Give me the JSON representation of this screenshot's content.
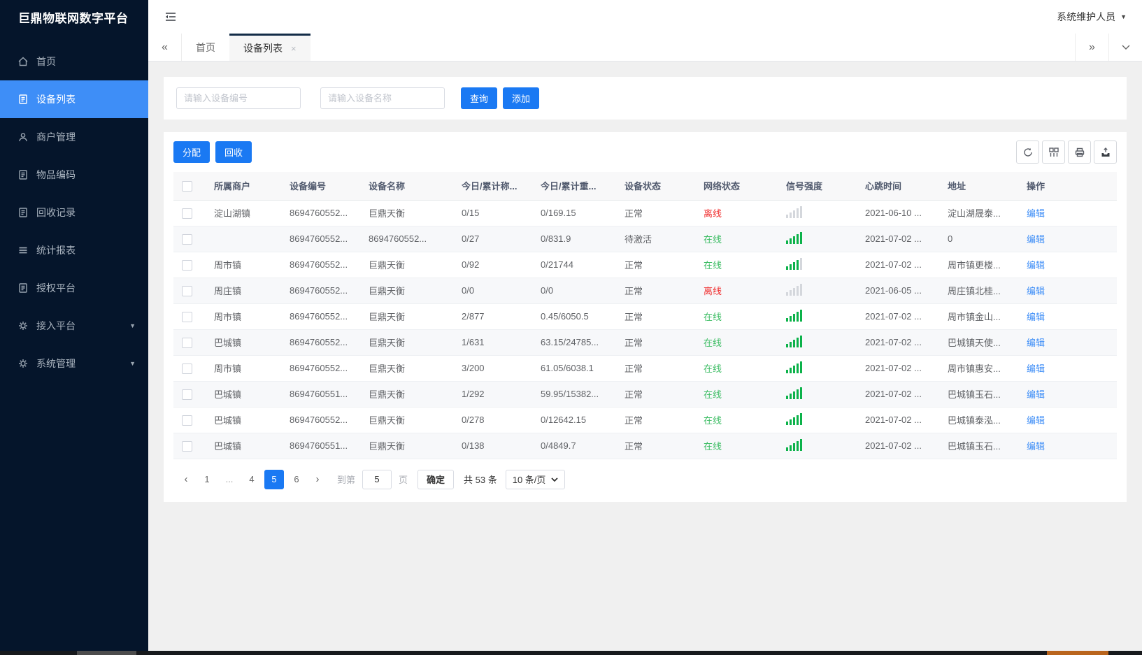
{
  "colors": {
    "accent": "#1a79f3",
    "sidebar-active": "#3e8ef7",
    "green": "#3dbd64",
    "bar-green": "#0cb24a",
    "red": "#f02d2d",
    "link": "#3e8ef7",
    "tab-border": "#132c47",
    "sidebar-bg": "#05152b"
  },
  "app": {
    "title": "巨鼎物联网数字平台"
  },
  "header": {
    "user": "系统维护人员",
    "user_caret": "▼"
  },
  "sidebar": {
    "items": [
      {
        "label": "首页",
        "icon": "home"
      },
      {
        "label": "设备列表",
        "icon": "device-list",
        "active": true
      },
      {
        "label": "商户管理",
        "icon": "merchant"
      },
      {
        "label": "物品编码",
        "icon": "item-code"
      },
      {
        "label": "回收记录",
        "icon": "recycle-record"
      },
      {
        "label": "统计报表",
        "icon": "report"
      },
      {
        "label": "授权平台",
        "icon": "authorize"
      },
      {
        "label": "接入平台",
        "icon": "access",
        "caret": "▼"
      },
      {
        "label": "系统管理",
        "icon": "system",
        "caret": "▼"
      }
    ]
  },
  "tabs": {
    "collapse": "«",
    "expand": "»",
    "items": [
      {
        "label": "首页",
        "active": false
      },
      {
        "label": "设备列表",
        "active": true,
        "close": "×"
      }
    ]
  },
  "search": {
    "device_no_placeholder": "请输入设备编号",
    "device_name_placeholder": "请输入设备名称",
    "query_label": "查询",
    "add_label": "添加"
  },
  "toolbar": {
    "assign_label": "分配",
    "recycle_label": "回收",
    "icons": [
      "refresh",
      "columns",
      "print",
      "export"
    ]
  },
  "table": {
    "columns": [
      "所属商户",
      "设备编号",
      "设备名称",
      "今日/累计称...",
      "今日/累计重...",
      "设备状态",
      "网络状态",
      "信号强度",
      "心跳时间",
      "地址",
      "操作"
    ],
    "rows": [
      {
        "merchant": "淀山湖镇",
        "device_no": "8694760552...",
        "device_name": "巨鼎天衡",
        "today_count": "0/15",
        "today_weight": "0/169.15",
        "device_status": "正常",
        "network_status": "离线",
        "network_online": false,
        "signal": 0,
        "heartbeat": "2021-06-10 ...",
        "address": "淀山湖晟泰...",
        "action": "编辑"
      },
      {
        "merchant": "",
        "device_no": "8694760552...",
        "device_name": "8694760552...",
        "today_count": "0/27",
        "today_weight": "0/831.9",
        "device_status": "待激活",
        "network_status": "在线",
        "network_online": true,
        "signal": 5,
        "heartbeat": "2021-07-02 ...",
        "address": "0",
        "action": "编辑"
      },
      {
        "merchant": "周市镇",
        "device_no": "8694760552...",
        "device_name": "巨鼎天衡",
        "today_count": "0/92",
        "today_weight": "0/21744",
        "device_status": "正常",
        "network_status": "在线",
        "network_online": true,
        "signal": 4,
        "heartbeat": "2021-07-02 ...",
        "address": "周市镇更楼...",
        "action": "编辑"
      },
      {
        "merchant": "周庄镇",
        "device_no": "8694760552...",
        "device_name": "巨鼎天衡",
        "today_count": "0/0",
        "today_weight": "0/0",
        "device_status": "正常",
        "network_status": "离线",
        "network_online": false,
        "signal": 0,
        "heartbeat": "2021-06-05 ...",
        "address": "周庄镇北桂...",
        "action": "编辑"
      },
      {
        "merchant": "周市镇",
        "device_no": "8694760552...",
        "device_name": "巨鼎天衡",
        "today_count": "2/877",
        "today_weight": "0.45/6050.5",
        "device_status": "正常",
        "network_status": "在线",
        "network_online": true,
        "signal": 5,
        "heartbeat": "2021-07-02 ...",
        "address": "周市镇金山...",
        "action": "编辑"
      },
      {
        "merchant": "巴城镇",
        "device_no": "8694760552...",
        "device_name": "巨鼎天衡",
        "today_count": "1/631",
        "today_weight": "63.15/24785...",
        "device_status": "正常",
        "network_status": "在线",
        "network_online": true,
        "signal": 5,
        "heartbeat": "2021-07-02 ...",
        "address": "巴城镇天使...",
        "action": "编辑"
      },
      {
        "merchant": "周市镇",
        "device_no": "8694760552...",
        "device_name": "巨鼎天衡",
        "today_count": "3/200",
        "today_weight": "61.05/6038.1",
        "device_status": "正常",
        "network_status": "在线",
        "network_online": true,
        "signal": 5,
        "heartbeat": "2021-07-02 ...",
        "address": "周市镇惠安...",
        "action": "编辑"
      },
      {
        "merchant": "巴城镇",
        "device_no": "8694760551...",
        "device_name": "巨鼎天衡",
        "today_count": "1/292",
        "today_weight": "59.95/15382...",
        "device_status": "正常",
        "network_status": "在线",
        "network_online": true,
        "signal": 5,
        "heartbeat": "2021-07-02 ...",
        "address": "巴城镇玉石...",
        "action": "编辑"
      },
      {
        "merchant": "巴城镇",
        "device_no": "8694760552...",
        "device_name": "巨鼎天衡",
        "today_count": "0/278",
        "today_weight": "0/12642.15",
        "device_status": "正常",
        "network_status": "在线",
        "network_online": true,
        "signal": 5,
        "heartbeat": "2021-07-02 ...",
        "address": "巴城镇泰泓...",
        "action": "编辑"
      },
      {
        "merchant": "巴城镇",
        "device_no": "8694760551...",
        "device_name": "巨鼎天衡",
        "today_count": "0/138",
        "today_weight": "0/4849.7",
        "device_status": "正常",
        "network_status": "在线",
        "network_online": true,
        "signal": 5,
        "heartbeat": "2021-07-02 ...",
        "address": "巴城镇玉石...",
        "action": "编辑"
      }
    ]
  },
  "pagination": {
    "prev": "‹",
    "next": "›",
    "pages": [
      "1",
      "...",
      "4",
      "5",
      "6"
    ],
    "active_page": "5",
    "goto_label": "到第",
    "goto_value": "5",
    "page_unit": "页",
    "confirm_label": "确定",
    "total_label": "共 53 条",
    "page_size": "10 条/页"
  }
}
